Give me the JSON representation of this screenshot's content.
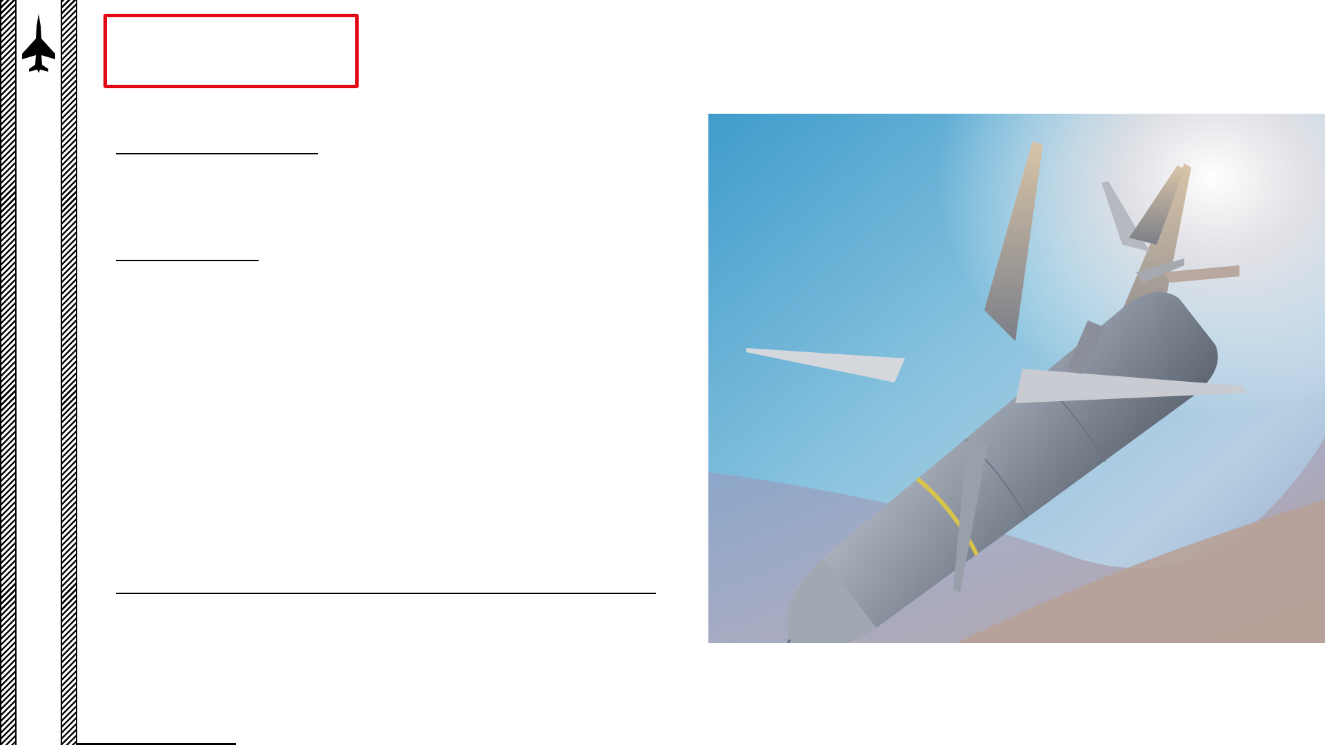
{
  "sidebar": {
    "icon": "fighter-jet-icon"
  },
  "header": {
    "border_color": "#e30613"
  },
  "image": {
    "subject": "missile-icon"
  }
}
